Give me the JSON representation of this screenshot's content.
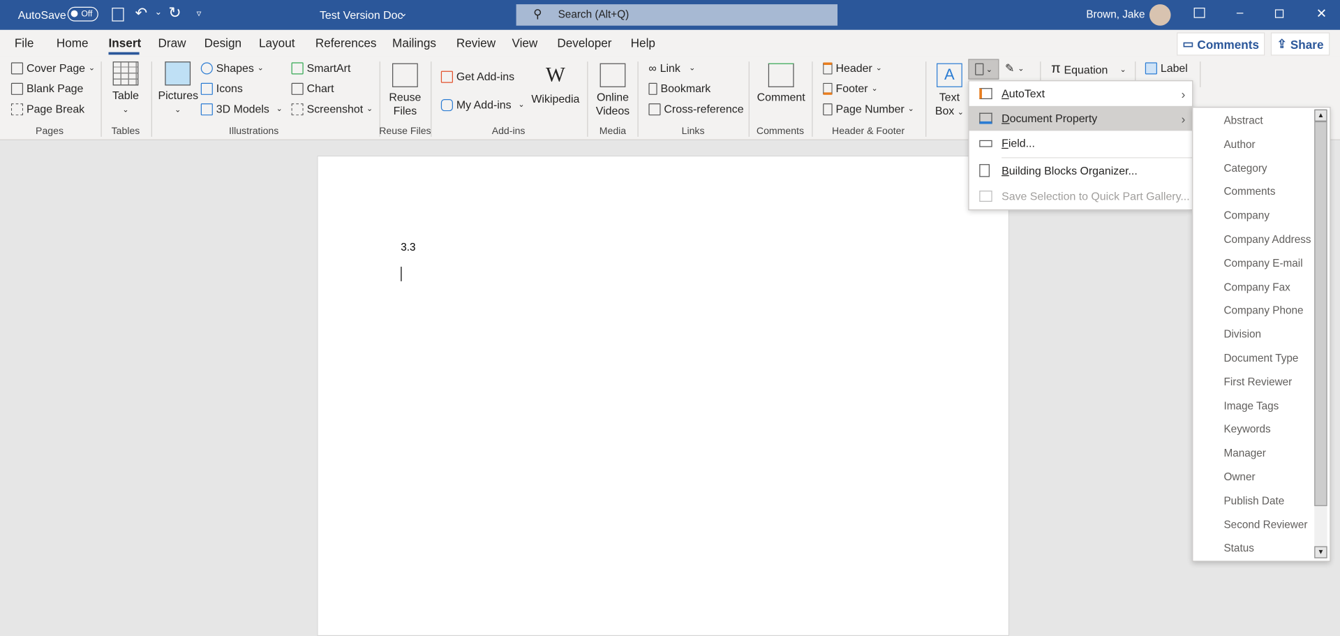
{
  "titlebar": {
    "autosave_label": "AutoSave",
    "autosave_state": "Off",
    "doc_title": "Test Version Doc",
    "search_placeholder": "Search (Alt+Q)",
    "user_name": "Brown, Jake",
    "color": "#2b579a"
  },
  "tabs": [
    {
      "label": "File"
    },
    {
      "label": "Home"
    },
    {
      "label": "Insert",
      "active": true
    },
    {
      "label": "Draw"
    },
    {
      "label": "Design"
    },
    {
      "label": "Layout"
    },
    {
      "label": "References"
    },
    {
      "label": "Mailings"
    },
    {
      "label": "Review"
    },
    {
      "label": "View"
    },
    {
      "label": "Developer"
    },
    {
      "label": "Help"
    }
  ],
  "actions": {
    "comments": "Comments",
    "share": "Share"
  },
  "ribbon": {
    "pages": {
      "label": "Pages",
      "cover": "Cover Page",
      "blank": "Blank Page",
      "break": "Page Break"
    },
    "tables": {
      "label": "Tables",
      "table": "Table"
    },
    "illustrations": {
      "label": "Illustrations",
      "pictures": "Pictures",
      "shapes": "Shapes",
      "icons": "Icons",
      "models": "3D Models",
      "smartart": "SmartArt",
      "chart": "Chart",
      "screenshot": "Screenshot"
    },
    "reuse": {
      "label": "Reuse Files",
      "reuse1": "Reuse",
      "reuse2": "Files"
    },
    "addins": {
      "label": "Add-ins",
      "get": "Get Add-ins",
      "my": "My Add-ins",
      "wikipedia": "Wikipedia"
    },
    "media": {
      "label": "Media",
      "v1": "Online",
      "v2": "Videos"
    },
    "links": {
      "label": "Links",
      "link": "Link",
      "bookmark": "Bookmark",
      "xref": "Cross-reference"
    },
    "comments": {
      "label": "Comments",
      "comment": "Comment"
    },
    "hf": {
      "label": "Header & Footer",
      "header": "Header",
      "footer": "Footer",
      "pagenum": "Page Number"
    },
    "text": {
      "tb1": "Text",
      "tb2": "Box",
      "equation": "Equation",
      "label": "Label"
    }
  },
  "document": {
    "text": "3.3"
  },
  "quickparts_menu": [
    {
      "label": "AutoText",
      "accel": "A",
      "rest": "utoText",
      "submenu": true
    },
    {
      "label": "Document Property",
      "accel": "D",
      "rest": "ocument Property",
      "submenu": true,
      "highlighted": true
    },
    {
      "label": "Field...",
      "accel": "F",
      "rest": "ield..."
    },
    {
      "label": "Building Blocks Organizer...",
      "accel": "B",
      "rest": "uilding Blocks Organizer..."
    },
    {
      "label": "Save Selection to Quick Part Gallery...",
      "disabled": true
    }
  ],
  "document_property_submenu": [
    "Abstract",
    "Author",
    "Category",
    "Comments",
    "Company",
    "Company Address",
    "Company E-mail",
    "Company Fax",
    "Company Phone",
    "Division",
    "Document Type",
    "First Reviewer",
    "Image Tags",
    "Keywords",
    "Manager",
    "Owner",
    "Publish Date",
    "Second Reviewer",
    "Status"
  ]
}
